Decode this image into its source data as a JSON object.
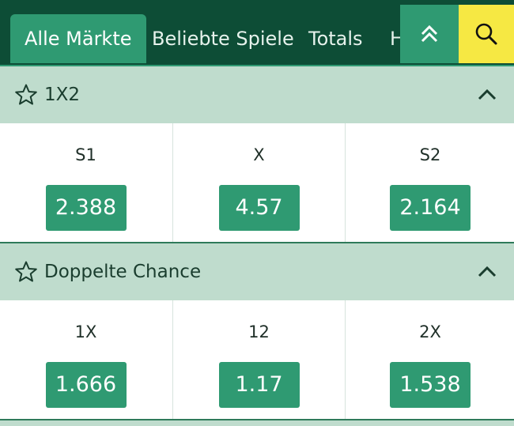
{
  "tabs": [
    {
      "label": "Alle Märkte",
      "active": true
    },
    {
      "label": "Beliebte Spiele",
      "active": false
    },
    {
      "label": "Totals",
      "active": false
    },
    {
      "label": "H",
      "active": false
    }
  ],
  "icons": {
    "scroll_up": "double-chevron-up-icon",
    "search": "search-icon",
    "favorite": "star-outline-icon",
    "collapse": "chevron-up-icon"
  },
  "colors": {
    "top_bar": "#0d4d36",
    "accent_green": "#2f9a72",
    "search_yellow": "#f6e843",
    "section_header": "#bfdccd"
  },
  "markets": [
    {
      "title": "1X2",
      "outcomes": [
        {
          "label": "S1",
          "odd": "2.388"
        },
        {
          "label": "X",
          "odd": "4.57"
        },
        {
          "label": "S2",
          "odd": "2.164"
        }
      ]
    },
    {
      "title": "Doppelte Chance",
      "outcomes": [
        {
          "label": "1X",
          "odd": "1.666"
        },
        {
          "label": "12",
          "odd": "1.17"
        },
        {
          "label": "2X",
          "odd": "1.538"
        }
      ]
    }
  ]
}
